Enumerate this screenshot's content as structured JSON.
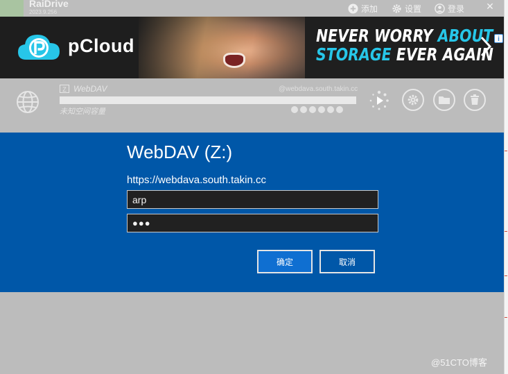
{
  "titlebar": {
    "app_name": "RaiDrive",
    "version": "2023.9.256",
    "add_label": "添加",
    "settings_label": "设置",
    "login_label": "登录",
    "close_glyph": "✕"
  },
  "ad": {
    "brand": "pCloud",
    "slogan_line1_white": "NEVER WORRY",
    "slogan_line1_blue": "ABOUT",
    "slogan_line2_blue": "STORAGE",
    "slogan_line2_white": "EVER AGAIN",
    "info_glyph": "i",
    "colors": {
      "accent": "#27c6e8",
      "background": "#1f1f1f"
    },
    "icons": [
      "pcloud-logo-icon",
      "chevron-right-icon",
      "ad-info-icon"
    ]
  },
  "drive": {
    "letter": "Z",
    "name": "WebDAV",
    "host": "@webdava.south.takin.cc",
    "usage_text": "未知空间容量",
    "icons": [
      "globe-icon",
      "spinner-icon",
      "play-icon",
      "gear-icon",
      "folder-icon",
      "trash-icon"
    ]
  },
  "dialog": {
    "title": "WebDAV (Z:)",
    "url": "https://webdava.south.takin.cc",
    "username_value": "arp",
    "password_mask": "●●●",
    "ok_label": "确定",
    "cancel_label": "取消",
    "colors": {
      "background": "#0057a8",
      "ok_button": "#0f6fd1",
      "field": "#212121"
    }
  },
  "watermark": "@51CTO博客"
}
